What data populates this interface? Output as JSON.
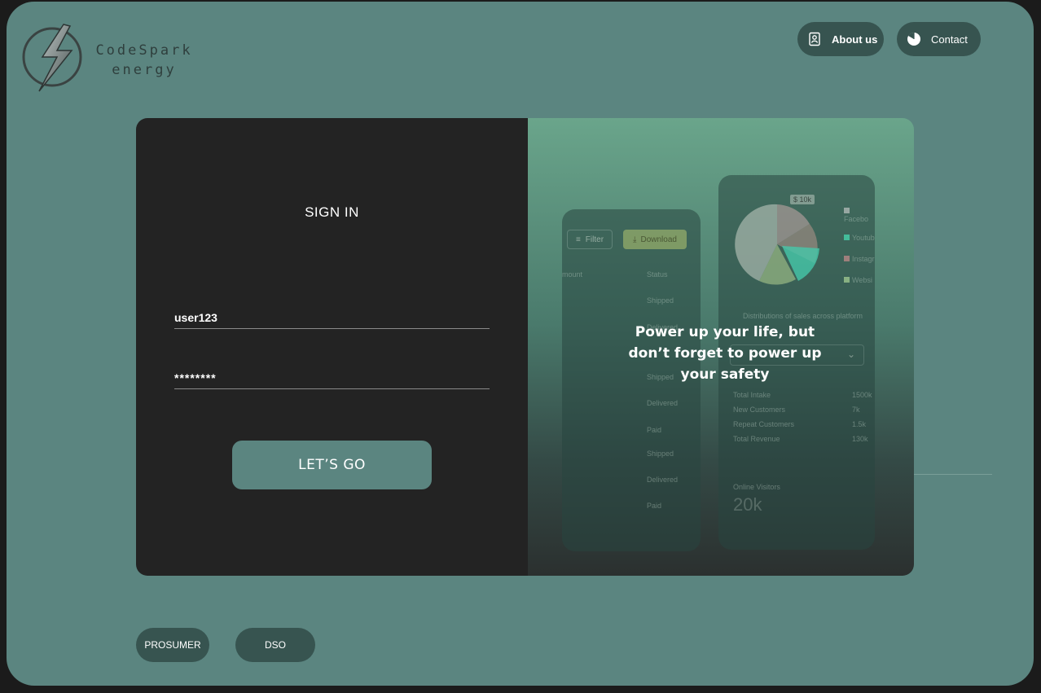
{
  "brand": {
    "name_line1": "CodeSpark",
    "name_line2": "energy",
    "logo_icon": "lightning-bolt-logo"
  },
  "header": {
    "about_label": "About us",
    "about_icon": "contact-card-icon",
    "contact_label": "Contact",
    "contact_icon": "pie-chart-icon"
  },
  "signin": {
    "title": "SIGN IN",
    "username_value": "user123",
    "password_value": "********",
    "submit_label": "LET’S GO"
  },
  "promo": {
    "tagline": "Power up your life, but don’t forget to power up your safety",
    "mock_filter": "Filter",
    "mock_download": "Download",
    "mock_amount": "mount",
    "mock_status": "Status",
    "mock_statuses": [
      "Shipped",
      "Delivered",
      "Shipped",
      "Delivered",
      "Paid",
      "Shipped",
      "Delivered",
      "Paid"
    ],
    "mock_badge": "$ 10k",
    "mock_legend": [
      "Facebo",
      "Youtub",
      "Instagr",
      "Websi"
    ],
    "mock_caption": "Distributions of sales across platform",
    "mock_stats": [
      {
        "label": "Total Intake",
        "value": "1500k"
      },
      {
        "label": "New Customers",
        "value": "7k"
      },
      {
        "label": "Repeat Customers",
        "value": "1.5k"
      },
      {
        "label": "Total Revenue",
        "value": "130k"
      }
    ],
    "mock_visitors_label": "Online Visitors",
    "mock_visitors_value": "20k"
  },
  "roles": {
    "prosumer_label": "PROSUMER",
    "dso_label": "DSO"
  },
  "colors": {
    "background": "#5b8580",
    "card_dark": "#232323",
    "pill": "#375450"
  }
}
